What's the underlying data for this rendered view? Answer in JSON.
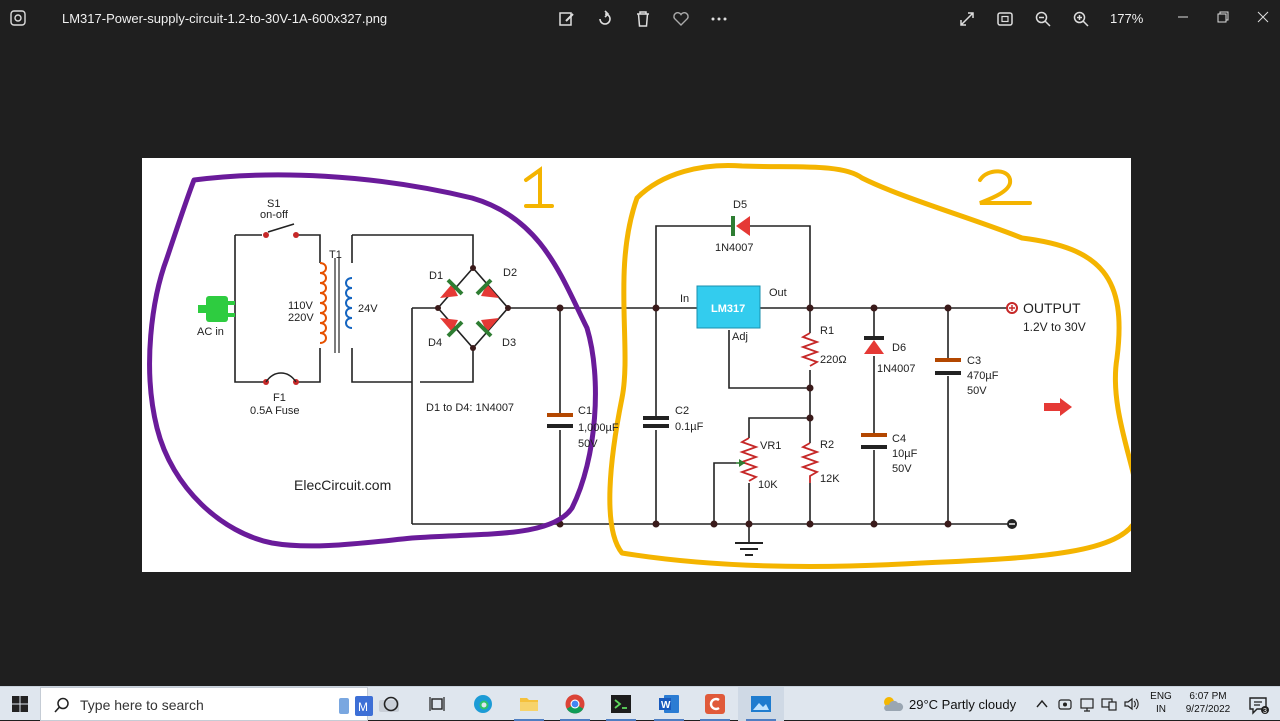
{
  "window": {
    "file_name": "LM317-Power-supply-circuit-1.2-to-30V-1A-600x327.png",
    "zoom": "177%"
  },
  "toolbar": {
    "buttons": [
      "edit-icon",
      "rotate-icon",
      "delete-icon",
      "favorite-icon",
      "more-icon"
    ],
    "view_buttons": [
      "full-screen-icon",
      "fit-window-icon",
      "zoom-out-icon",
      "zoom-in-icon"
    ]
  },
  "circuit": {
    "section_1_label": "1",
    "section_2_label": "2",
    "s1_label": "S1",
    "s1_sub": "on-off",
    "t1_label": "T1",
    "primary_v1": "110V",
    "primary_v2": "220V",
    "secondary_v": "24V",
    "ac_in": "AC in",
    "fuse_label": "F1",
    "fuse_sub": "0.5A Fuse",
    "d1": "D1",
    "d2": "D2",
    "d3": "D3",
    "d4": "D4",
    "diode_note": "D1 to D4: 1N4007",
    "c1_label": "C1",
    "c1_val": "1,000µF",
    "c1_volt": "50V",
    "c2_label": "C2",
    "c2_val": "0.1µF",
    "d5_label": "D5",
    "d5_part": "1N4007",
    "reg_in": "In",
    "reg_name": "LM317",
    "reg_out": "Out",
    "reg_adj": "Adj",
    "r1_label": "R1",
    "r1_val": "220Ω",
    "d6_label": "D6",
    "d6_part": "1N4007",
    "c3_label": "C3",
    "c3_val": "470µF",
    "c3_volt": "50V",
    "output_label": "OUTPUT",
    "output_range": "1.2V to 30V",
    "vr1_label": "VR1",
    "vr1_val": "10K",
    "r2_label": "R2",
    "r2_val": "12K",
    "c4_label": "C4",
    "c4_val": "10µF",
    "c4_volt": "50V",
    "credit": "ElecCircuit.com"
  },
  "taskbar": {
    "search_placeholder": "Type here to search",
    "apps": [
      "task-view-icon",
      "edge-icon",
      "file-explorer-icon",
      "chrome-icon",
      "terminal-app-icon",
      "word-icon",
      "red-app-icon",
      "photos-icon"
    ],
    "weather": "29°C  Partly cloudy",
    "lang_top": "ENG",
    "lang_bottom": "IN",
    "time": "6:07 PM",
    "date": "9/27/2022"
  },
  "colors": {
    "purple_annotation": "#6a1b9a",
    "orange_annotation": "#f4b400",
    "regulator": "#33ccee",
    "wire": "#222222"
  }
}
